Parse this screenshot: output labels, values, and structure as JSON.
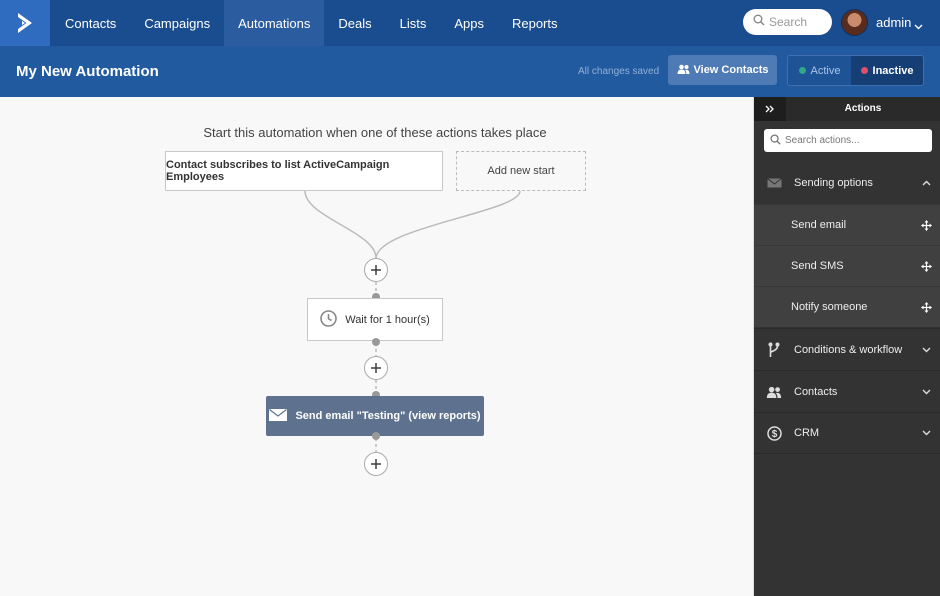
{
  "nav": {
    "items": [
      {
        "label": "Contacts"
      },
      {
        "label": "Campaigns"
      },
      {
        "label": "Automations"
      },
      {
        "label": "Deals"
      },
      {
        "label": "Lists"
      },
      {
        "label": "Apps"
      },
      {
        "label": "Reports"
      }
    ],
    "active": "Automations",
    "search_placeholder": "Search",
    "user_name": "admin"
  },
  "header": {
    "title": "My New Automation",
    "save_status": "All changes saved",
    "view_contacts_label": "View Contacts",
    "status_active_label": "Active",
    "status_inactive_label": "Inactive",
    "active_dot_color": "#2fa88a",
    "inactive_dot_color": "#e0506a",
    "selected_status": "Inactive"
  },
  "canvas": {
    "start_prompt": "Start this automation when one of these actions takes place",
    "trigger_label": "Contact subscribes to list ActiveCampaign Employees",
    "add_start_label": "Add new start",
    "wait_label": "Wait for 1 hour(s)",
    "email_label": "Send email \"Testing\" (view reports)"
  },
  "sidebar": {
    "title": "Actions",
    "search_placeholder": "Search actions...",
    "sections": [
      {
        "label": "Sending options",
        "icon": "envelope-icon",
        "expanded": true,
        "items": [
          {
            "label": "Send email"
          },
          {
            "label": "Send SMS"
          },
          {
            "label": "Notify someone"
          }
        ]
      },
      {
        "label": "Conditions & workflow",
        "icon": "branch-icon",
        "expanded": false
      },
      {
        "label": "Contacts",
        "icon": "users-icon",
        "expanded": false
      },
      {
        "label": "CRM",
        "icon": "dollar-icon",
        "expanded": false
      }
    ]
  },
  "colors": {
    "nav_bg": "#1a4d8f",
    "subheader_bg": "#225aa0",
    "email_node_bg": "#5e7290",
    "sidebar_bg": "#333333"
  }
}
